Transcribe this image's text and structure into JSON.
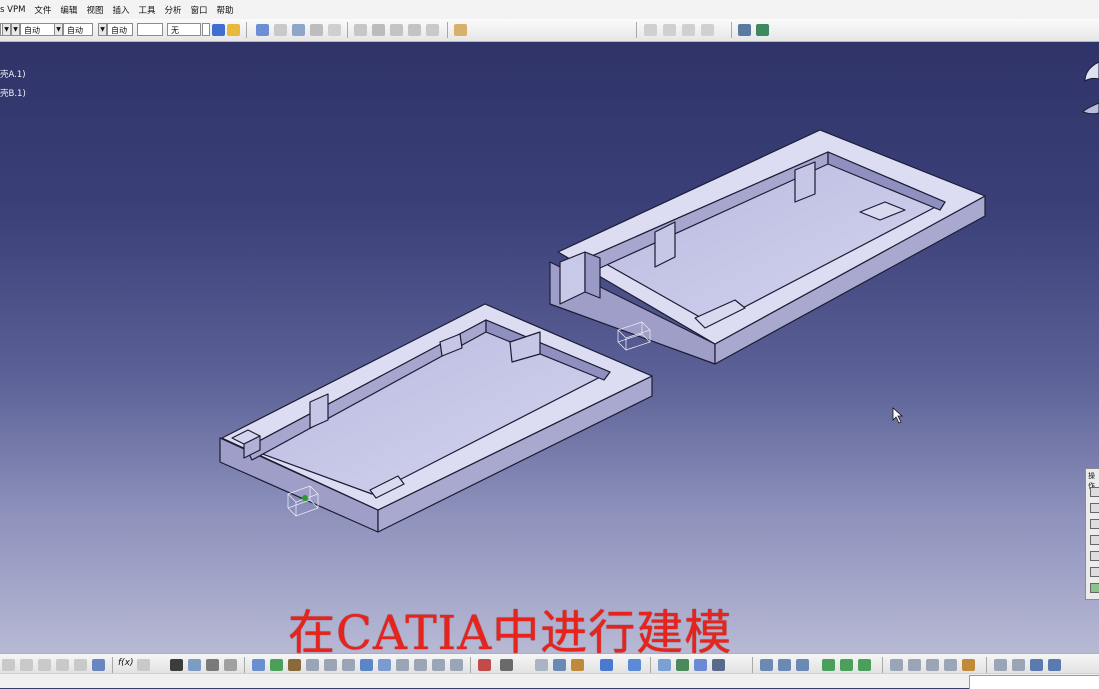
{
  "menu": {
    "items": [
      "s VPM",
      "文件",
      "编辑",
      "视图",
      "插入",
      "工具",
      "分析",
      "窗口",
      "帮助"
    ]
  },
  "toolbar_top": {
    "combos": [
      "自动",
      "自动",
      "自动",
      "",
      "",
      "无"
    ]
  },
  "tree": {
    "nodes": [
      "壳A.1)",
      "壳B.1)"
    ]
  },
  "ops_panel": {
    "title": "操作"
  },
  "bottom_toolbar": {
    "formula_label": "f(x)"
  },
  "caption": {
    "text": "在CATIA中进行建模"
  },
  "colors": {
    "part_face": "#c4c4e4",
    "part_top": "#dedef2",
    "part_side": "#9e9ec8",
    "edge": "#1c1c34",
    "caption": "#e8231c",
    "background_top": "#2f3368",
    "background_bottom": "#b7b9d4"
  }
}
